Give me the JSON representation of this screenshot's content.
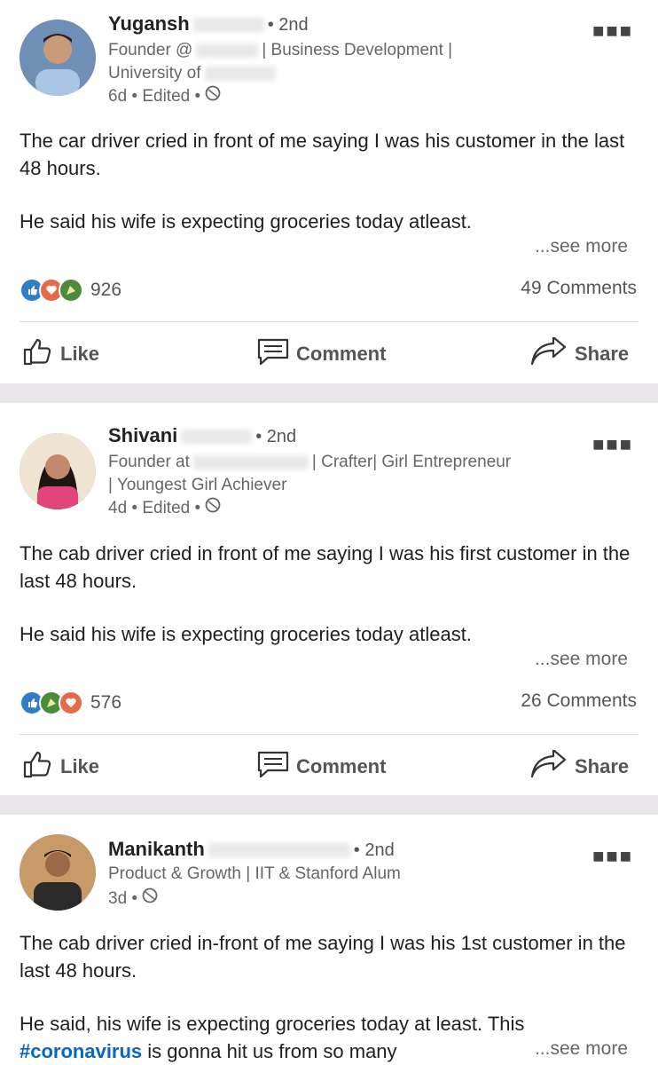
{
  "posts": [
    {
      "name": "Yugansh",
      "degree": "• 2nd",
      "headline_1": "Founder @",
      "headline_1b": "| Business Development |",
      "headline_2": "University of",
      "time": "6d • Edited •",
      "para_1": "The car driver cried in front of me saying I was his customer in the last 48 hours.",
      "para_2": "He said his wife is expecting groceries today atleast.",
      "see_more": "...see more",
      "reaction_count": "926",
      "comments": "49 Comments",
      "actions": {
        "like": "Like",
        "comment": "Comment",
        "share": "Share"
      }
    },
    {
      "name": "Shivani",
      "degree": "• 2nd",
      "headline_1": "Founder at",
      "headline_1b": "| Crafter| Girl Entrepreneur",
      "headline_2": "| Youngest Girl Achiever",
      "time": "4d • Edited •",
      "para_1": "The cab driver cried in front of me saying I was his first customer in the last 48 hours.",
      "para_2": "He said his wife is expecting groceries today atleast.",
      "see_more": "...see more",
      "reaction_count": "576",
      "comments": "26 Comments",
      "actions": {
        "like": "Like",
        "comment": "Comment",
        "share": "Share"
      }
    },
    {
      "name": "Manikanth",
      "degree": "• 2nd",
      "headline_1": "Product & Growth | IIT & Stanford Alum",
      "time": "3d •",
      "para_1": "The cab driver cried in-front of me saying I was his 1st customer in the last 48 hours.",
      "para_2a": "He said, his wife is expecting groceries today at least. This",
      "hashtag": "#coronavirus",
      "para_2b": "is gonna hit us from so many",
      "see_more": "...see more"
    }
  ],
  "colors": {
    "like": "#2f7ec7",
    "love": "#e56a4a",
    "celebrate": "#4b8b3b",
    "hashtag": "#0a66c2"
  },
  "icons": [
    "ellipsis-icon",
    "like-reaction-icon",
    "love-reaction-icon",
    "celebrate-reaction-icon",
    "thumbs-up-icon",
    "comment-icon",
    "share-icon",
    "globe-icon"
  ]
}
